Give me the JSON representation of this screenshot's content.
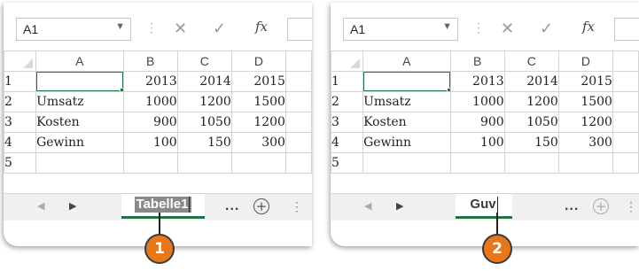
{
  "panels": [
    {
      "name_box": "A1",
      "fx_label": "fx",
      "column_headers": [
        "A",
        "B",
        "C",
        "D"
      ],
      "rows": [
        {
          "num": "1",
          "label": "",
          "values": [
            "2013",
            "2014",
            "2015"
          ]
        },
        {
          "num": "2",
          "label": "Umsatz",
          "values": [
            "1000",
            "1200",
            "1500"
          ]
        },
        {
          "num": "3",
          "label": "Kosten",
          "values": [
            "900",
            "1050",
            "1200"
          ]
        },
        {
          "num": "4",
          "label": "Gewinn",
          "values": [
            "100",
            "150",
            "300"
          ]
        },
        {
          "num": "5",
          "label": "",
          "values": [
            "",
            "",
            ""
          ]
        }
      ],
      "sheet_tab": "Tabelle1",
      "more_tabs": "...",
      "add_sheet": "+",
      "callout": "1"
    },
    {
      "name_box": "A1",
      "fx_label": "fx",
      "column_headers": [
        "A",
        "B",
        "C",
        "D"
      ],
      "rows": [
        {
          "num": "1",
          "label": "",
          "values": [
            "2013",
            "2014",
            "2015"
          ]
        },
        {
          "num": "2",
          "label": "Umsatz",
          "values": [
            "1000",
            "1200",
            "1500"
          ]
        },
        {
          "num": "3",
          "label": "Kosten",
          "values": [
            "900",
            "1050",
            "1200"
          ]
        },
        {
          "num": "4",
          "label": "Gewinn",
          "values": [
            "100",
            "150",
            "300"
          ]
        },
        {
          "num": "5",
          "label": "",
          "values": [
            "",
            "",
            ""
          ]
        }
      ],
      "sheet_tab": "Guv",
      "more_tabs": "...",
      "add_sheet": "+",
      "callout": "2"
    }
  ],
  "colors": {
    "selection": "#217346",
    "callout_fill": "#e8761a",
    "tab_highlight": "#8a8a8a"
  }
}
